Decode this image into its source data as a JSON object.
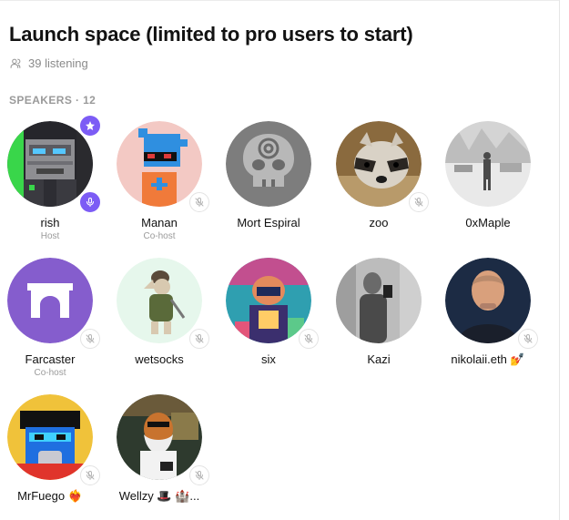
{
  "space": {
    "title": "Launch space (limited to pro users to start)",
    "listening": "39 listening",
    "speakers_label": "SPEAKERS · 12"
  },
  "colors": {
    "accent": "#7c5cf5",
    "muted_text": "#8a8a8a",
    "farcaster_purple": "#855dcd"
  },
  "icons": {
    "listeners": "users-icon",
    "host_badge": "star-icon",
    "mic_on": "microphone-icon",
    "mic_off": "microphone-muted-icon"
  },
  "speakers": [
    {
      "name": "rish",
      "role": "Host",
      "mic": "on"
    },
    {
      "name": "Manan",
      "role": "Co-host",
      "mic": "off"
    },
    {
      "name": "Mort Espiral",
      "role": "",
      "mic": "none"
    },
    {
      "name": "zoo",
      "role": "",
      "mic": "off"
    },
    {
      "name": "0xMaple",
      "role": "",
      "mic": "none"
    },
    {
      "name": "Farcaster",
      "role": "Co-host",
      "mic": "off"
    },
    {
      "name": "wetsocks",
      "role": "",
      "mic": "off"
    },
    {
      "name": "six",
      "role": "",
      "mic": "off"
    },
    {
      "name": "Kazi",
      "role": "",
      "mic": "none"
    },
    {
      "name": "nikolaii.eth 💅",
      "role": "",
      "mic": "off"
    },
    {
      "name": "MrFuego ❤️‍🔥",
      "role": "",
      "mic": "off"
    },
    {
      "name": "Wellzy 🎩 🏰...",
      "role": "",
      "mic": "off"
    }
  ]
}
